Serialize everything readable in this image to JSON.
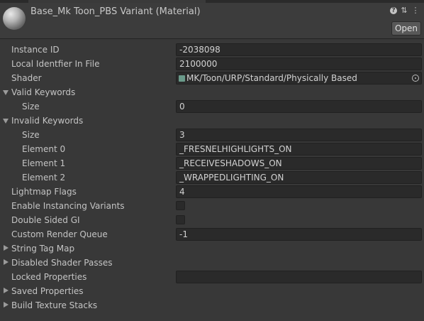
{
  "header": {
    "title": "Base_Mk Toon_PBS Variant (Material)",
    "open_label": "Open",
    "icons": [
      "help-icon",
      "settings-sliders-icon",
      "kebab-menu-icon"
    ]
  },
  "rows": {
    "instance_id": {
      "label": "Instance ID",
      "value": "-2038098"
    },
    "local_identifier": {
      "label": "Local Identfier In File",
      "value": "2100000"
    },
    "shader": {
      "label": "Shader",
      "value": "MK/Toon/URP/Standard/Physically Based"
    },
    "valid_keywords": {
      "label": "Valid Keywords",
      "size_label": "Size",
      "size_value": "0"
    },
    "invalid_keywords": {
      "label": "Invalid Keywords",
      "size_label": "Size",
      "size_value": "3",
      "elements": [
        {
          "label": "Element 0",
          "value": "_FRESNELHIGHLIGHTS_ON"
        },
        {
          "label": "Element 1",
          "value": "_RECEIVESHADOWS_ON"
        },
        {
          "label": "Element 2",
          "value": "_WRAPPEDLIGHTING_ON"
        }
      ]
    },
    "lightmap_flags": {
      "label": "Lightmap Flags",
      "value": "4"
    },
    "enable_instancing": {
      "label": "Enable Instancing Variants"
    },
    "double_sided_gi": {
      "label": "Double Sided GI"
    },
    "custom_render_queue": {
      "label": "Custom Render Queue",
      "value": "-1"
    },
    "string_tag_map": {
      "label": "String Tag Map"
    },
    "disabled_shader_passes": {
      "label": "Disabled Shader Passes"
    },
    "locked_properties": {
      "label": "Locked Properties",
      "value": ""
    },
    "saved_properties": {
      "label": "Saved Properties"
    },
    "build_texture_stacks": {
      "label": "Build Texture Stacks"
    }
  }
}
